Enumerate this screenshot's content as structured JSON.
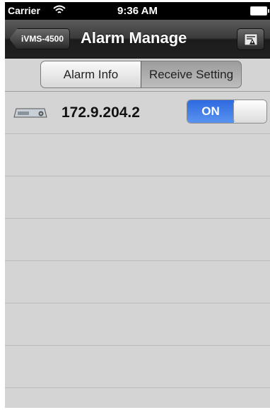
{
  "status_bar": {
    "carrier": "Carrier",
    "time": "9:36 AM"
  },
  "nav": {
    "back_label": "iVMS-4500",
    "title": "Alarm Manage",
    "right_icon": "alarm-settings-icon"
  },
  "segments": {
    "left": "Alarm Info",
    "right": "Receive Setting",
    "selected": "Receive Setting"
  },
  "devices": [
    {
      "ip": "172.9.204.2",
      "switch_label": "ON",
      "switch_on": true,
      "icon": "dvr-device-icon"
    }
  ],
  "colors": {
    "switch_on": "#3b7be6",
    "nav_dark": "#2a2a2a",
    "background": "#d4d4d4"
  }
}
